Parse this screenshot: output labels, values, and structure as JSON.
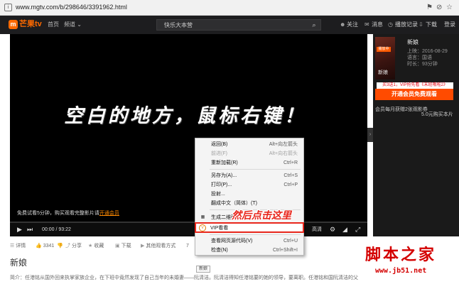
{
  "browser": {
    "url": "www.mgtv.com/b/298646/3391962.html"
  },
  "header": {
    "logo_text": "芒果tv",
    "nav_home": "首页",
    "nav_channel": "频道",
    "search_value": "快乐大本营",
    "follow": "关注",
    "message": "消息",
    "history": "播放记录",
    "download": "下载",
    "login": "登录"
  },
  "player": {
    "caption": "空白的地方，鼠标右键！",
    "trial_text": "免费试看5分钟，购买观看完整影片请",
    "trial_link": "开通会员",
    "time": "00:00 / 93:22",
    "quality": "高清",
    "progress": 0
  },
  "panel": {
    "poster_badge": "播放中",
    "poster_title": "新娘",
    "title": "新娘",
    "online": "上映：2016-08-29",
    "language": "语言：国语",
    "duration": "时长：93分钟",
    "vip_promo": "买3送1，VIP抢先看《末班哦啦2》",
    "vip_button": "开通会员免费观看",
    "note1": "会员每月获赠2张观影券",
    "note2": "5.0元购买本片"
  },
  "actions": {
    "detail": "详情",
    "likes": "3341",
    "share": "分享",
    "favorite": "收藏",
    "download": "下载",
    "other": "其他观看方式",
    "partial": "7"
  },
  "content": {
    "title": "新娘",
    "intro": "简介：任港铭从国外回来执掌家族企业，在下班中竟然发现了自己当年的未婚妻——阮清洁。阮清洁得知任港铭要的她的领导，要离职。任港铭和国阮清洁的父"
  },
  "context_menu": {
    "items": [
      {
        "label": "返回(B)",
        "shortcut": "Alt+向左箭头",
        "disabled": false
      },
      {
        "label": "前进(F)",
        "shortcut": "Alt+向右箭头",
        "disabled": true
      },
      {
        "label": "重新加载(R)",
        "shortcut": "Ctrl+R",
        "disabled": false
      },
      {
        "label": "另存为(A)...",
        "shortcut": "Ctrl+S",
        "disabled": false
      },
      {
        "label": "打印(P)...",
        "shortcut": "Ctrl+P",
        "disabled": false
      },
      {
        "label": "投射...",
        "shortcut": "",
        "disabled": false
      },
      {
        "label": "翻成中文（简体）(T)",
        "shortcut": "",
        "disabled": false
      },
      {
        "label": "生成二维码",
        "shortcut": "",
        "disabled": false
      }
    ],
    "vip_item": "VIP看看",
    "items_after": [
      {
        "label": "查看网页源代码(V)",
        "shortcut": "Ctrl+U"
      },
      {
        "label": "检查(N)",
        "shortcut": "Ctrl+Shift+I"
      }
    ]
  },
  "annotation": "然后点击这里",
  "tooltip": "新娘",
  "watermark": {
    "title": "脚本之家",
    "url": "www.jb51.net"
  },
  "colors": {
    "brand": "#ff6a00",
    "highlight": "#e8261c",
    "watermark": "#d40000"
  }
}
